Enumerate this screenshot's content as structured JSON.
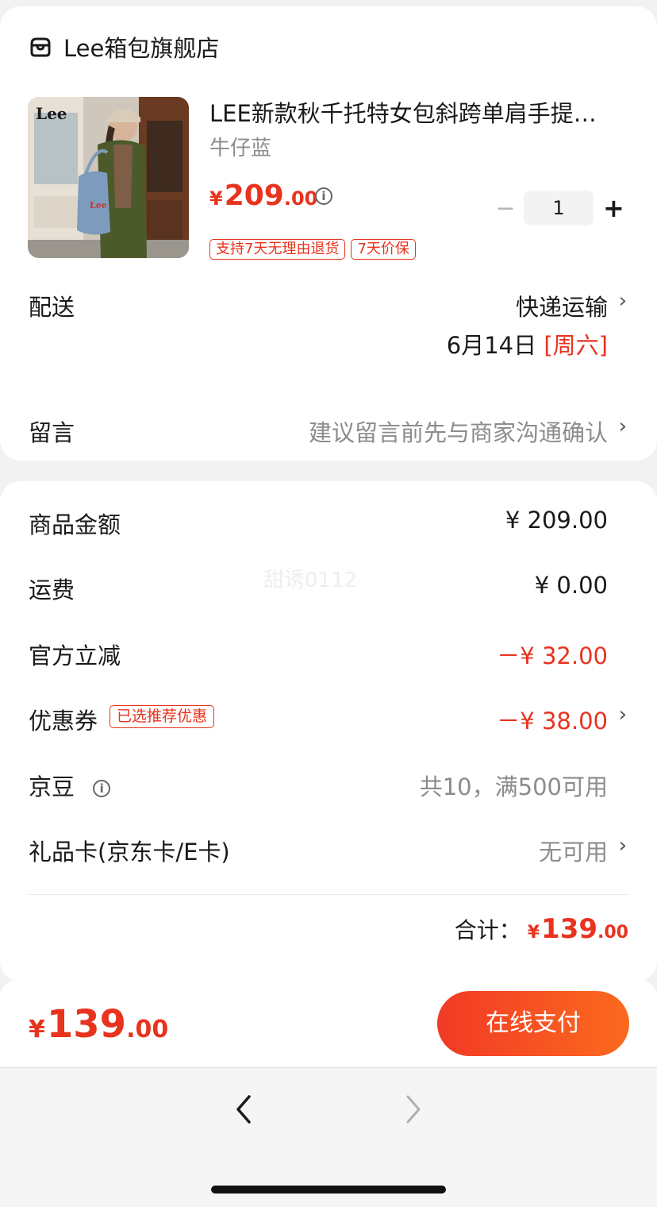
{
  "shop": {
    "name": "Lee箱包旗舰店",
    "icon": "store-icon"
  },
  "product": {
    "image_alt": "LEE bag product photo",
    "title": "LEE新款秋千托特女包斜跨单肩手提…",
    "variant": "牛仔蓝",
    "price_currency": "¥",
    "price_int": "209",
    "price_dec": ".00",
    "price_info_icon": "info-icon",
    "quantity": "1",
    "qty_minus": "−",
    "qty_plus": "+",
    "tags": [
      "支持7天无理由退货",
      "7天价保"
    ]
  },
  "delivery": {
    "label": "配送",
    "method": "快递运输",
    "date": "6月14日",
    "weekday": "[周六]"
  },
  "message": {
    "label": "留言",
    "placeholder": "建议留言前先与商家沟通确认"
  },
  "price_detail": {
    "goods_label": "商品金额",
    "goods_value": "¥ 209.00",
    "shipping_label": "运费",
    "shipping_value": "¥ 0.00",
    "discount_label": "官方立减",
    "discount_value": "－¥ 32.00",
    "coupon_label": "优惠券",
    "coupon_tag": "已选推荐优惠",
    "coupon_value": "－¥ 38.00",
    "beans_label": "京豆",
    "beans_value": "共10，满500可用",
    "giftcard_label": "礼品卡(京东卡/E卡)",
    "giftcard_value": "无可用",
    "total_label": "合计：",
    "total_currency": "¥",
    "total_int": "139",
    "total_dec": ".00",
    "watermark": "甜诱0112"
  },
  "bottom_bar": {
    "currency": "¥",
    "int": "139",
    "dec": ".00",
    "pay_label": "在线支付"
  },
  "colors": {
    "accent": "#e8331f",
    "button_start": "#f23a26",
    "button_end": "#fb6a1e"
  }
}
